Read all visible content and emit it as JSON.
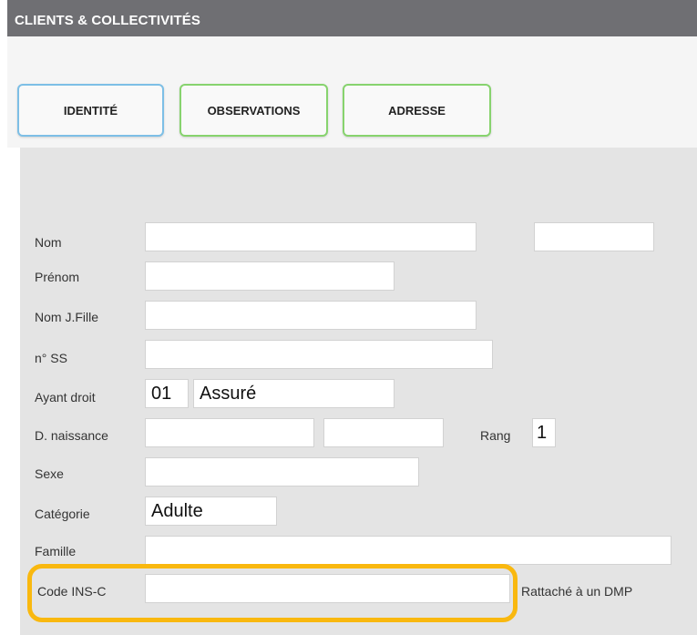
{
  "app": {
    "title": "CLIENTS & COLLECTIVITÉS"
  },
  "tabs": [
    {
      "label": "IDENTITÉ",
      "active": true
    },
    {
      "label": "OBSERVATIONS",
      "active": false
    },
    {
      "label": "ADRESSE",
      "active": false
    }
  ],
  "form": {
    "nom": {
      "label": "Nom",
      "value": "",
      "extra_value": ""
    },
    "prenom": {
      "label": "Prénom",
      "value": ""
    },
    "nom_jfille": {
      "label": "Nom J.Fille",
      "value": ""
    },
    "nss": {
      "label": "n° SS",
      "value": ""
    },
    "ayant_droit": {
      "label": "Ayant droit",
      "code": "01",
      "text": "Assuré"
    },
    "naissance": {
      "label": "D. naissance",
      "value": "",
      "value2": ""
    },
    "rang": {
      "label": "Rang",
      "value": "1"
    },
    "sexe": {
      "label": "Sexe",
      "value": ""
    },
    "categorie": {
      "label": "Catégorie",
      "value": "Adulte"
    },
    "famille": {
      "label": "Famille",
      "value": ""
    },
    "code_ins": {
      "label": "Code INS-C",
      "value": ""
    },
    "dmp": {
      "label": "Rattaché à un DMP"
    }
  },
  "colors": {
    "titlebar": "#6f6f73",
    "tab_border": "#87d36e",
    "tab_active_border": "#7dbfe6",
    "highlight": "#f9b80f",
    "panel": "#e4e4e4"
  }
}
